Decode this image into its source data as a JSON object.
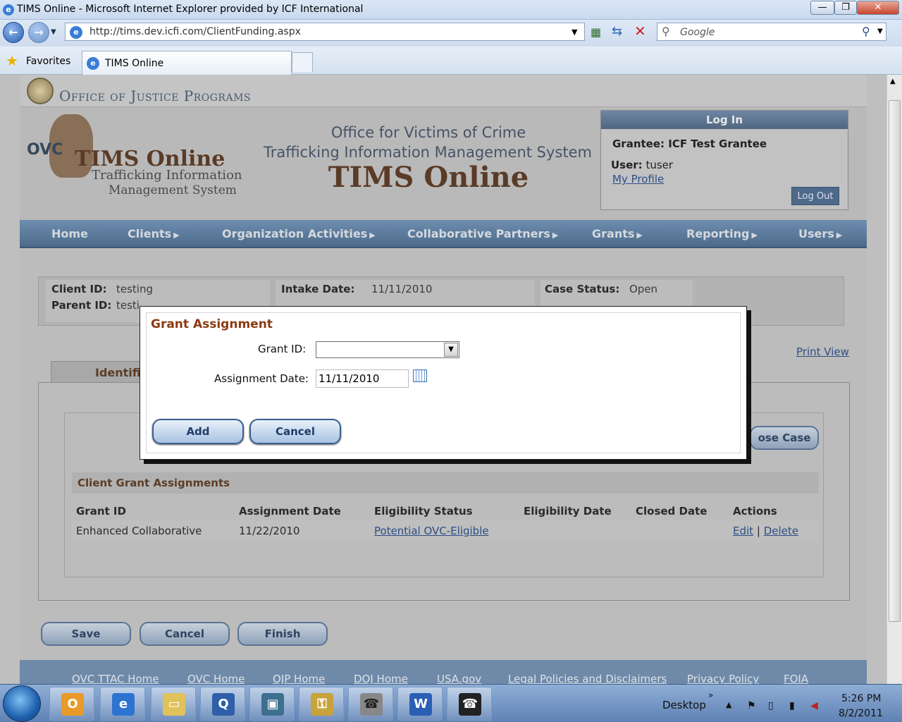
{
  "window": {
    "title": "TIMS Online - Microsoft Internet Explorer provided by ICF International",
    "minimize": "—",
    "restore": "❐",
    "close": "✕"
  },
  "browser": {
    "url": "http://tims.dev.icfi.com/ClientFunding.aspx",
    "search_placeholder": "Google",
    "favorites_label": "Favorites",
    "tab_label": "TIMS Online"
  },
  "site": {
    "agency": "Office of Justice Programs",
    "logo_ovc": "OVC",
    "logo_title": "TIMS Online",
    "logo_sub1": "Trafficking Information",
    "logo_sub2": "Management System",
    "header_line1": "Office for Victims of Crime",
    "header_line2": "Trafficking Information Management System",
    "header_big": "TIMS Online"
  },
  "login": {
    "heading": "Log In",
    "grantee": "Grantee: ICF Test Grantee",
    "user_label": "User:",
    "user_value": "tuser",
    "profile_link": "My Profile",
    "logout": "Log Out"
  },
  "nav": [
    "Home",
    "Clients",
    "Organization Activities",
    "Collaborative Partners",
    "Grants",
    "Reporting",
    "Users"
  ],
  "client_info": {
    "client_id_label": "Client ID:",
    "client_id": "testing",
    "parent_id_label": "Parent ID:",
    "parent_id": "testi",
    "intake_label": "Intake Date:",
    "intake_date": "11/11/2010",
    "case_status_label": "Case Status:",
    "case_status": "Open"
  },
  "tab_identification": "Identific",
  "print_view": "Print View",
  "close_case": "ose Case",
  "grants_table": {
    "title": "Client Grant Assignments",
    "headers": [
      "Grant ID",
      "Assignment Date",
      "Eligibility Status",
      "Eligibility Date",
      "Closed Date",
      "Actions"
    ],
    "rows": [
      {
        "grant_id": "Enhanced Collaborative",
        "assignment_date": "11/22/2010",
        "eligibility_status": "Potential OVC-Eligible",
        "eligibility_date": "",
        "closed_date": "",
        "edit": "Edit",
        "sep": "|",
        "delete": "Delete"
      }
    ]
  },
  "page_buttons": {
    "save": "Save",
    "cancel": "Cancel",
    "finish": "Finish"
  },
  "footer": [
    "OVC TTAC Home",
    "OVC Home",
    "OJP Home",
    "DOJ Home",
    "USA.gov",
    "Legal Policies and Disclaimers",
    "Privacy Policy",
    "FOIA"
  ],
  "modal": {
    "title": "Grant Assignment",
    "grant_id_label": "Grant ID:",
    "grant_id_value": "",
    "assignment_date_label": "Assignment Date:",
    "assignment_date_value": "11/11/2010",
    "add": "Add",
    "cancel": "Cancel"
  },
  "taskbar": {
    "desktop": "Desktop",
    "time": "5:26 PM",
    "date": "8/2/2011",
    "apps": [
      "outlook-icon",
      "ie-icon",
      "explorer-icon",
      "app-icon",
      "network-icon",
      "security-icon",
      "phone-icon",
      "word-icon",
      "app2-icon"
    ]
  }
}
